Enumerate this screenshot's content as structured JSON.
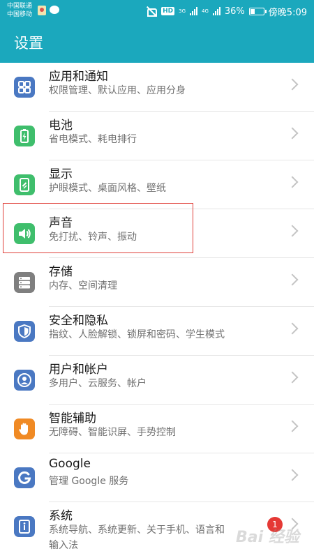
{
  "status_bar": {
    "carrier_1": "中国联通",
    "carrier_2": "中国移动",
    "hd_label": "HD",
    "net_1": "3G",
    "net_2": "4G",
    "battery_text": "36%",
    "battery_level": 0.36,
    "time": "傍晚5:09"
  },
  "app_bar": {
    "title": "设置",
    "color": "#1ba8bd"
  },
  "items": [
    {
      "title": "应用和通知",
      "subtitle": "权限管理、默认应用、应用分身",
      "icon": "apps-grid-icon",
      "color": "#4a78c2"
    },
    {
      "title": "电池",
      "subtitle": "省电模式、耗电排行",
      "icon": "battery-icon",
      "color": "#3fbe6c"
    },
    {
      "title": "显示",
      "subtitle": "护眼模式、桌面风格、壁纸",
      "icon": "display-icon",
      "color": "#3fbe6c"
    },
    {
      "title": "声音",
      "subtitle": "免打扰、铃声、振动",
      "icon": "sound-icon",
      "color": "#3fbe6c"
    },
    {
      "title": "存储",
      "subtitle": "内存、空间清理",
      "icon": "storage-icon",
      "color": "#7f7f7f"
    },
    {
      "title": "安全和隐私",
      "subtitle": "指纹、人脸解锁、锁屏和密码、学生模式",
      "icon": "shield-icon",
      "color": "#4a78c2"
    },
    {
      "title": "用户和帐户",
      "subtitle": "多用户、云服务、帐户",
      "icon": "user-icon",
      "color": "#4a78c2"
    },
    {
      "title": "智能辅助",
      "subtitle": "无障碍、智能识屏、手势控制",
      "icon": "hand-icon",
      "color": "#f08a24"
    },
    {
      "title": "Google",
      "subtitle": "管理 Google 服务",
      "icon": "google-icon",
      "color": "#4a78c2"
    },
    {
      "title": "系统",
      "subtitle": "系统导航、系统更新、关于手机、语言和",
      "subtitle_line2": "输入法",
      "icon": "system-info-icon",
      "color": "#4a78c2",
      "badge": "1"
    }
  ],
  "watermark": "Bai 经验"
}
